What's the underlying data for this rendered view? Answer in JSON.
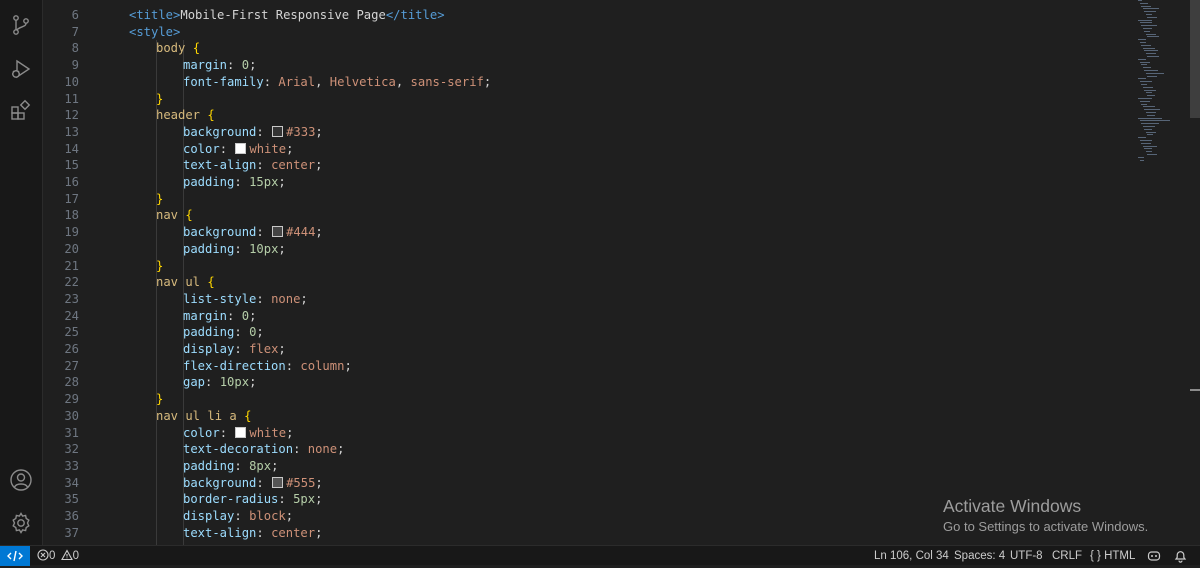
{
  "activity_bar": {
    "items": [
      {
        "name": "source-control",
        "icon": "source-control-icon"
      },
      {
        "name": "run-and-debug",
        "icon": "run-debug-icon"
      },
      {
        "name": "extensions",
        "icon": "extensions-icon"
      }
    ],
    "bottom": [
      {
        "name": "accounts",
        "icon": "account-icon"
      },
      {
        "name": "manage",
        "icon": "gear-icon"
      }
    ]
  },
  "editor": {
    "language": "HTML",
    "lines": [
      {
        "n": "6",
        "indent": 1,
        "tokens": [
          [
            "tag",
            "<title>"
          ],
          [
            "txt",
            "Mobile-First Responsive Page"
          ],
          [
            "tag",
            "</title>"
          ]
        ]
      },
      {
        "n": "7",
        "indent": 1,
        "tokens": [
          [
            "tag",
            "<style>"
          ]
        ]
      },
      {
        "n": "8",
        "indent": 2,
        "tokens": [
          [
            "sel",
            "body "
          ],
          [
            "brace",
            "{"
          ]
        ]
      },
      {
        "n": "9",
        "indent": 3,
        "tokens": [
          [
            "prop",
            "margin"
          ],
          [
            "punc",
            ": "
          ],
          [
            "num",
            "0"
          ],
          [
            "punc",
            ";"
          ]
        ]
      },
      {
        "n": "10",
        "indent": 3,
        "tokens": [
          [
            "prop",
            "font-family"
          ],
          [
            "punc",
            ": "
          ],
          [
            "val",
            "Arial"
          ],
          [
            "punc",
            ", "
          ],
          [
            "val",
            "Helvetica"
          ],
          [
            "punc",
            ", "
          ],
          [
            "val",
            "sans-serif"
          ],
          [
            "punc",
            ";"
          ]
        ]
      },
      {
        "n": "11",
        "indent": 2,
        "tokens": [
          [
            "brace",
            "}"
          ]
        ]
      },
      {
        "n": "12",
        "indent": 2,
        "tokens": [
          [
            "sel",
            "header "
          ],
          [
            "brace",
            "{"
          ]
        ]
      },
      {
        "n": "13",
        "indent": 3,
        "tokens": [
          [
            "prop",
            "background"
          ],
          [
            "punc",
            ": "
          ],
          [
            "swatch",
            "#333333"
          ],
          [
            "val",
            "#333"
          ],
          [
            "punc",
            ";"
          ]
        ]
      },
      {
        "n": "14",
        "indent": 3,
        "tokens": [
          [
            "prop",
            "color"
          ],
          [
            "punc",
            ": "
          ],
          [
            "swatch",
            "#ffffff"
          ],
          [
            "val",
            "white"
          ],
          [
            "punc",
            ";"
          ]
        ]
      },
      {
        "n": "15",
        "indent": 3,
        "tokens": [
          [
            "prop",
            "text-align"
          ],
          [
            "punc",
            ": "
          ],
          [
            "val",
            "center"
          ],
          [
            "punc",
            ";"
          ]
        ]
      },
      {
        "n": "16",
        "indent": 3,
        "tokens": [
          [
            "prop",
            "padding"
          ],
          [
            "punc",
            ": "
          ],
          [
            "num",
            "15px"
          ],
          [
            "punc",
            ";"
          ]
        ]
      },
      {
        "n": "17",
        "indent": 2,
        "tokens": [
          [
            "brace",
            "}"
          ]
        ]
      },
      {
        "n": "18",
        "indent": 2,
        "tokens": [
          [
            "sel",
            "nav "
          ],
          [
            "brace",
            "{"
          ]
        ]
      },
      {
        "n": "19",
        "indent": 3,
        "tokens": [
          [
            "prop",
            "background"
          ],
          [
            "punc",
            ": "
          ],
          [
            "swatch",
            "#444444"
          ],
          [
            "val",
            "#444"
          ],
          [
            "punc",
            ";"
          ]
        ]
      },
      {
        "n": "20",
        "indent": 3,
        "tokens": [
          [
            "prop",
            "padding"
          ],
          [
            "punc",
            ": "
          ],
          [
            "num",
            "10px"
          ],
          [
            "punc",
            ";"
          ]
        ]
      },
      {
        "n": "21",
        "indent": 2,
        "tokens": [
          [
            "brace",
            "}"
          ]
        ]
      },
      {
        "n": "22",
        "indent": 2,
        "tokens": [
          [
            "sel",
            "nav ul "
          ],
          [
            "brace",
            "{"
          ]
        ]
      },
      {
        "n": "23",
        "indent": 3,
        "tokens": [
          [
            "prop",
            "list-style"
          ],
          [
            "punc",
            ": "
          ],
          [
            "val",
            "none"
          ],
          [
            "punc",
            ";"
          ]
        ]
      },
      {
        "n": "24",
        "indent": 3,
        "tokens": [
          [
            "prop",
            "margin"
          ],
          [
            "punc",
            ": "
          ],
          [
            "num",
            "0"
          ],
          [
            "punc",
            ";"
          ]
        ]
      },
      {
        "n": "25",
        "indent": 3,
        "tokens": [
          [
            "prop",
            "padding"
          ],
          [
            "punc",
            ": "
          ],
          [
            "num",
            "0"
          ],
          [
            "punc",
            ";"
          ]
        ]
      },
      {
        "n": "26",
        "indent": 3,
        "tokens": [
          [
            "prop",
            "display"
          ],
          [
            "punc",
            ": "
          ],
          [
            "val",
            "flex"
          ],
          [
            "punc",
            ";"
          ]
        ]
      },
      {
        "n": "27",
        "indent": 3,
        "tokens": [
          [
            "prop",
            "flex-direction"
          ],
          [
            "punc",
            ": "
          ],
          [
            "val",
            "column"
          ],
          [
            "punc",
            ";"
          ]
        ]
      },
      {
        "n": "28",
        "indent": 3,
        "tokens": [
          [
            "prop",
            "gap"
          ],
          [
            "punc",
            ": "
          ],
          [
            "num",
            "10px"
          ],
          [
            "punc",
            ";"
          ]
        ]
      },
      {
        "n": "29",
        "indent": 2,
        "tokens": [
          [
            "brace",
            "}"
          ]
        ]
      },
      {
        "n": "30",
        "indent": 2,
        "tokens": [
          [
            "sel",
            "nav ul li a "
          ],
          [
            "brace",
            "{"
          ]
        ]
      },
      {
        "n": "31",
        "indent": 3,
        "tokens": [
          [
            "prop",
            "color"
          ],
          [
            "punc",
            ": "
          ],
          [
            "swatch",
            "#ffffff"
          ],
          [
            "val",
            "white"
          ],
          [
            "punc",
            ";"
          ]
        ]
      },
      {
        "n": "32",
        "indent": 3,
        "tokens": [
          [
            "prop",
            "text-decoration"
          ],
          [
            "punc",
            ": "
          ],
          [
            "val",
            "none"
          ],
          [
            "punc",
            ";"
          ]
        ]
      },
      {
        "n": "33",
        "indent": 3,
        "tokens": [
          [
            "prop",
            "padding"
          ],
          [
            "punc",
            ": "
          ],
          [
            "num",
            "8px"
          ],
          [
            "punc",
            ";"
          ]
        ]
      },
      {
        "n": "34",
        "indent": 3,
        "tokens": [
          [
            "prop",
            "background"
          ],
          [
            "punc",
            ": "
          ],
          [
            "swatch",
            "#555555"
          ],
          [
            "val",
            "#555"
          ],
          [
            "punc",
            ";"
          ]
        ]
      },
      {
        "n": "35",
        "indent": 3,
        "tokens": [
          [
            "prop",
            "border-radius"
          ],
          [
            "punc",
            ": "
          ],
          [
            "num",
            "5px"
          ],
          [
            "punc",
            ";"
          ]
        ]
      },
      {
        "n": "36",
        "indent": 3,
        "tokens": [
          [
            "prop",
            "display"
          ],
          [
            "punc",
            ": "
          ],
          [
            "val",
            "block"
          ],
          [
            "punc",
            ";"
          ]
        ]
      },
      {
        "n": "37",
        "indent": 3,
        "tokens": [
          [
            "prop",
            "text-align"
          ],
          [
            "punc",
            ": "
          ],
          [
            "val",
            "center"
          ],
          [
            "punc",
            ";"
          ]
        ]
      }
    ]
  },
  "watermark": {
    "title": "Activate Windows",
    "subtitle": "Go to Settings to activate Windows."
  },
  "status_bar": {
    "errors": "0",
    "warnings": "0",
    "cursor": "Ln 106, Col 34",
    "indent": "Spaces: 4",
    "encoding": "UTF-8",
    "eol": "CRLF",
    "language": "HTML",
    "language_prefix": "{ }",
    "colors": {
      "remote_bg": "#0078d4",
      "bar_bg": "#181818"
    }
  }
}
